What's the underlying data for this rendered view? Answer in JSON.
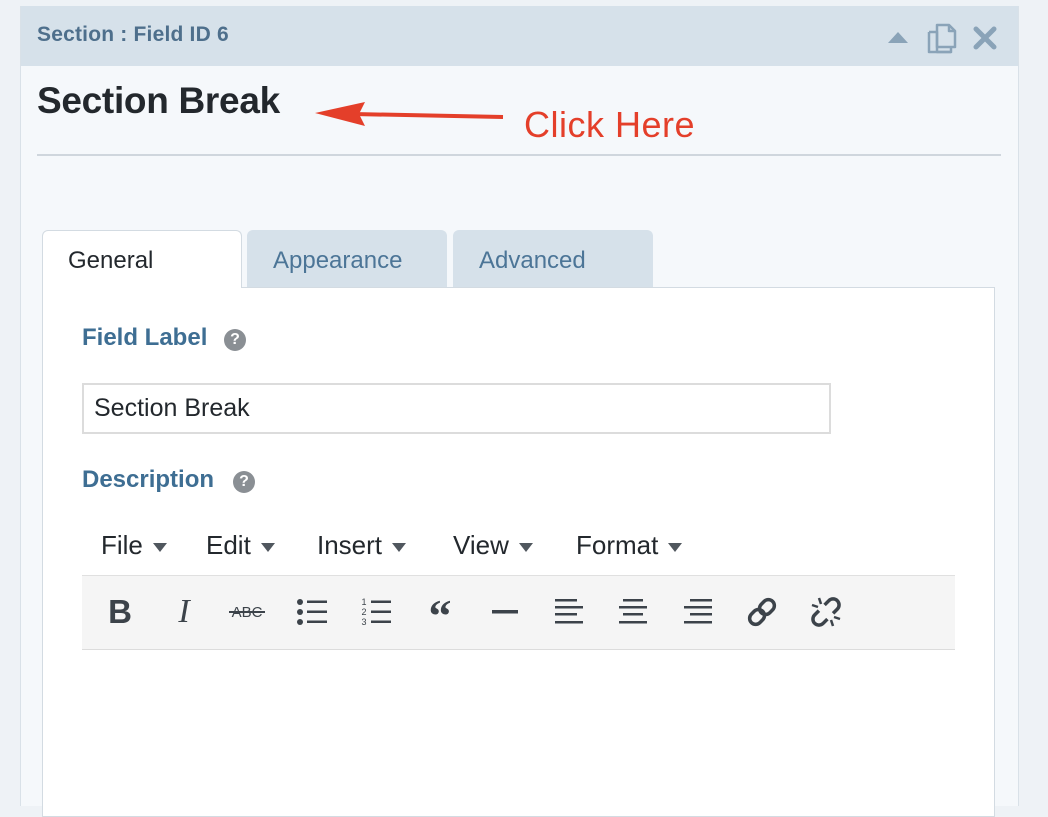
{
  "header": {
    "title": "Section : Field ID 6",
    "icons": [
      "collapse-up-icon",
      "duplicate-icon",
      "close-icon"
    ]
  },
  "field_title": "Section Break",
  "annotation": {
    "text": "Click Here",
    "color": "#e43f2a"
  },
  "tabs": [
    {
      "label": "General",
      "active": true
    },
    {
      "label": "Appearance",
      "active": false
    },
    {
      "label": "Advanced",
      "active": false
    }
  ],
  "general": {
    "field_label": {
      "label": "Field Label",
      "value": "Section Break"
    },
    "description": {
      "label": "Description",
      "menus": [
        "File",
        "Edit",
        "Insert",
        "View",
        "Format"
      ],
      "toolbar": [
        {
          "name": "bold",
          "glyph": "B"
        },
        {
          "name": "italic",
          "glyph": "I"
        },
        {
          "name": "strikethrough",
          "glyph": "ABC"
        },
        {
          "name": "bulleted-list"
        },
        {
          "name": "numbered-list",
          "glyph_numbers": [
            "1",
            "2",
            "3"
          ]
        },
        {
          "name": "blockquote",
          "glyph": "“"
        },
        {
          "name": "horizontal-line"
        },
        {
          "name": "align-left"
        },
        {
          "name": "align-center"
        },
        {
          "name": "align-right"
        },
        {
          "name": "insert-link"
        },
        {
          "name": "remove-link"
        }
      ]
    }
  },
  "colors": {
    "header_bg": "#d6e1ea",
    "label_blue": "#3e6e93",
    "tab_text": "#4c7597",
    "annotation_red": "#e43f2a"
  }
}
